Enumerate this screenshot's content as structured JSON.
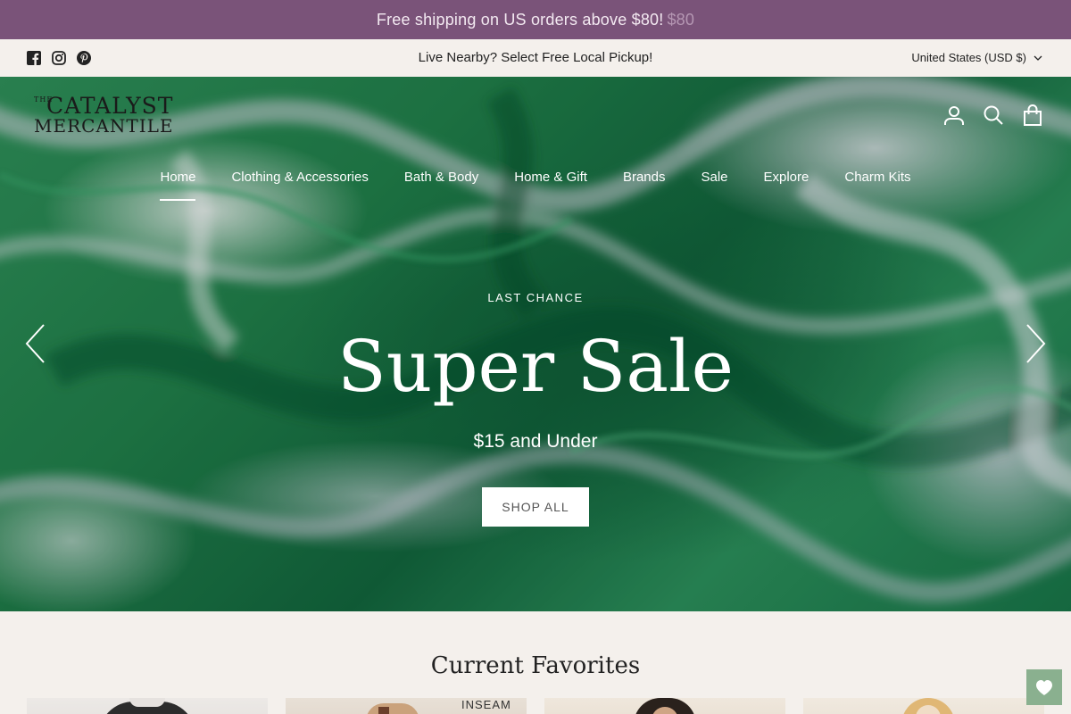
{
  "announcement": {
    "text": "Free shipping on US orders above $80!",
    "muted_price": "$80",
    "background": "#7a5379"
  },
  "utility": {
    "socials": [
      "facebook-icon",
      "instagram-icon",
      "pinterest-icon"
    ],
    "local_pickup": "Live Nearby? Select Free Local Pickup!",
    "currency": "United States (USD $)"
  },
  "header": {
    "logo_the": "THE",
    "logo_line1": "CATALYST",
    "logo_line2": "MERCANTILE",
    "icons": [
      "account-icon",
      "search-icon",
      "cart-icon"
    ]
  },
  "nav": {
    "items": [
      {
        "label": "Home",
        "active": true
      },
      {
        "label": "Clothing & Accessories"
      },
      {
        "label": "Bath & Body"
      },
      {
        "label": "Home & Gift"
      },
      {
        "label": "Brands"
      },
      {
        "label": "Sale"
      },
      {
        "label": "Explore"
      },
      {
        "label": "Charm Kits"
      }
    ]
  },
  "hero": {
    "kicker": "LAST CHANCE",
    "title": "Super Sale",
    "subtitle": "$15 and Under",
    "button": "SHOP ALL",
    "prev_icon": "chevron-left-icon",
    "next_icon": "chevron-right-icon"
  },
  "favorites": {
    "heading": "Current Favorites",
    "card_label": "INSEAM"
  },
  "wishlist": {
    "icon": "heart-icon",
    "color": "#8ab08f"
  }
}
